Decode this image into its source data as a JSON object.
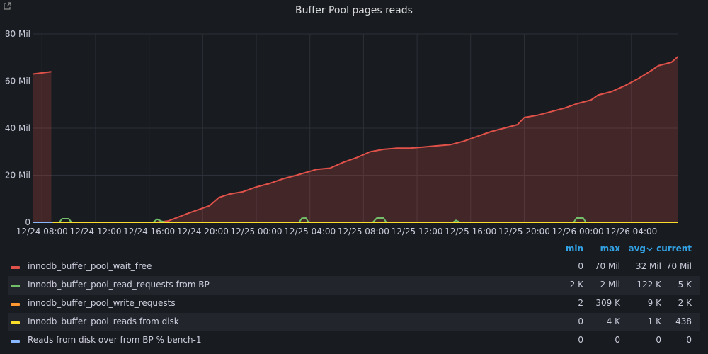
{
  "panel": {
    "title": "Buffer Pool pages reads",
    "link_icon": "external-link-icon"
  },
  "legend": {
    "columns": [
      "min",
      "max",
      "avg",
      "current"
    ],
    "sort_icon": "chevron-down-icon",
    "rows": [
      {
        "name": "innodb_buffer_pool_wait_free",
        "color": "#e0514a",
        "min": "0",
        "max": "70 Mil",
        "avg": "32 Mil",
        "current": "70 Mil"
      },
      {
        "name": "Innodb_buffer_pool_read_requests from BP",
        "color": "#73bf69",
        "min": "2 K",
        "max": "2 Mil",
        "avg": "122 K",
        "current": "5 K"
      },
      {
        "name": "innodb_buffer_pool_write_requests",
        "color": "#ff9830",
        "min": "2",
        "max": "309 K",
        "avg": "9 K",
        "current": "2 K"
      },
      {
        "name": "Innodb_buffer_pool_reads from disk",
        "color": "#fade2a",
        "min": "0",
        "max": "4 K",
        "avg": "1 K",
        "current": "438"
      },
      {
        "name": "Reads from disk over from BP % bench-1",
        "color": "#8ab8ff",
        "min": "0",
        "max": "0",
        "avg": "0",
        "current": "0"
      }
    ]
  },
  "chart_data": {
    "type": "area",
    "title": "Buffer Pool pages reads",
    "xlim_hours": [
      -0.65,
      47.5
    ],
    "x_note_origin": "12/24 08:00",
    "ylim": [
      0,
      80000000
    ],
    "y_ticks": [
      0,
      20000000,
      40000000,
      60000000,
      80000000
    ],
    "y_tick_labels": [
      "0",
      "20 Mil",
      "40 Mil",
      "60 Mil",
      "80 Mil"
    ],
    "x_ticks_hours": [
      0,
      4,
      8,
      12,
      16,
      20,
      24,
      28,
      32,
      36,
      40,
      44
    ],
    "x_tick_labels": [
      "12/24 08:00",
      "12/24 12:00",
      "12/24 16:00",
      "12/24 20:00",
      "12/25 00:00",
      "12/25 04:00",
      "12/25 08:00",
      "12/25 12:00",
      "12/25 16:00",
      "12/25 20:00",
      "12/26 00:00",
      "12/26 04:00"
    ],
    "grid": true,
    "series": [
      {
        "name": "innodb_buffer_pool_wait_free",
        "color": "#e0514a",
        "fill": true,
        "segments": [
          [
            [
              -0.65,
              63000000
            ],
            [
              0.7,
              64000000
            ]
          ],
          [
            [
              0.7,
              0
            ],
            [
              2,
              0
            ],
            [
              6,
              0
            ],
            [
              8.5,
              0
            ],
            [
              9.4,
              500000
            ],
            [
              11,
              4000000
            ],
            [
              12.5,
              7000000
            ],
            [
              13.2,
              10500000
            ],
            [
              14,
              12000000
            ],
            [
              15,
              13000000
            ],
            [
              16,
              15000000
            ],
            [
              17,
              16500000
            ],
            [
              18,
              18500000
            ],
            [
              19,
              20000000
            ],
            [
              20.5,
              22500000
            ],
            [
              21.5,
              23000000
            ],
            [
              22.5,
              25500000
            ],
            [
              23.5,
              27500000
            ],
            [
              24.5,
              30000000
            ],
            [
              25.5,
              31000000
            ],
            [
              26.5,
              31500000
            ],
            [
              27.5,
              31500000
            ],
            [
              28.5,
              32000000
            ],
            [
              29.5,
              32500000
            ],
            [
              30.5,
              33000000
            ],
            [
              31.5,
              34500000
            ],
            [
              32.5,
              36500000
            ],
            [
              33.5,
              38500000
            ],
            [
              34.5,
              40000000
            ],
            [
              35.5,
              41500000
            ],
            [
              36,
              44500000
            ],
            [
              37,
              45500000
            ],
            [
              38,
              47000000
            ],
            [
              39,
              48500000
            ],
            [
              40,
              50500000
            ],
            [
              41,
              52000000
            ],
            [
              41.5,
              54000000
            ],
            [
              42.5,
              55500000
            ],
            [
              43.5,
              58000000
            ],
            [
              44.5,
              61000000
            ],
            [
              45.5,
              64500000
            ],
            [
              46,
              66500000
            ],
            [
              47,
              68000000
            ],
            [
              47.5,
              70500000
            ]
          ]
        ]
      },
      {
        "name": "Innodb_buffer_pool_read_requests from BP",
        "color": "#73bf69",
        "fill": false,
        "segments": [
          [
            [
              -0.65,
              0
            ],
            [
              1.3,
              0
            ],
            [
              1.5,
              1500000
            ],
            [
              2,
              1500000
            ],
            [
              2.2,
              0
            ],
            [
              8.3,
              0
            ],
            [
              8.6,
              1300000
            ],
            [
              8.9,
              500000
            ],
            [
              9.2,
              0
            ],
            [
              19.2,
              0
            ],
            [
              19.4,
              1700000
            ],
            [
              19.7,
              1800000
            ],
            [
              19.9,
              0
            ],
            [
              24.7,
              0
            ],
            [
              25,
              1800000
            ],
            [
              25.5,
              1800000
            ],
            [
              25.7,
              0
            ],
            [
              30.7,
              0
            ],
            [
              30.9,
              800000
            ],
            [
              31.2,
              0
            ],
            [
              39.7,
              0
            ],
            [
              39.9,
              1800000
            ],
            [
              40.4,
              1800000
            ],
            [
              40.6,
              0
            ],
            [
              47.5,
              0
            ]
          ]
        ]
      },
      {
        "name": "innodb_buffer_pool_write_requests",
        "color": "#ff9830",
        "fill": false,
        "segments": [
          [
            [
              -0.65,
              0
            ],
            [
              47.5,
              0
            ]
          ]
        ]
      },
      {
        "name": "Innodb_buffer_pool_reads from disk",
        "color": "#fade2a",
        "fill": false,
        "segments": [
          [
            [
              -0.65,
              0
            ],
            [
              47.5,
              0
            ]
          ]
        ]
      },
      {
        "name": "Reads from disk over from BP % bench-1",
        "color": "#8ab8ff",
        "fill": false,
        "segments": [
          [
            [
              -0.65,
              0
            ],
            [
              0.8,
              0
            ]
          ]
        ]
      }
    ]
  }
}
